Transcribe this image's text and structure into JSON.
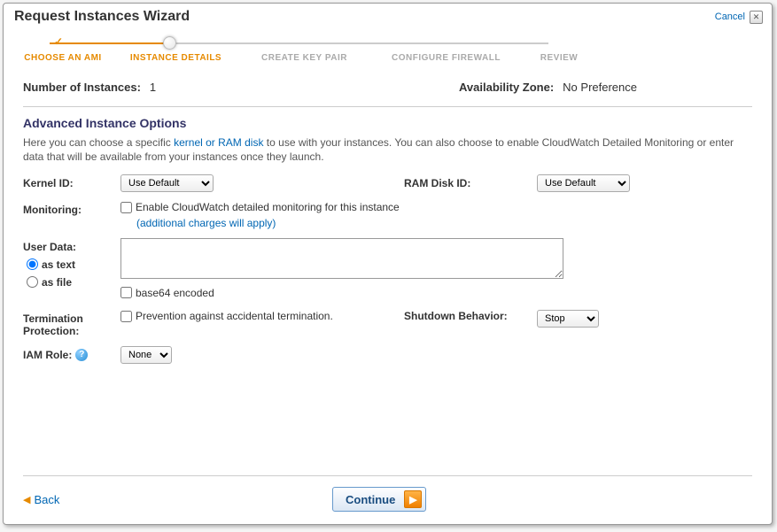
{
  "title": "Request Instances Wizard",
  "cancel": "Cancel",
  "close": "✕",
  "steps": {
    "choose_ami": "CHOOSE AN AMI",
    "instance_details": "INSTANCE DETAILS",
    "create_key_pair": "CREATE KEY PAIR",
    "configure_firewall": "CONFIGURE FIREWALL",
    "review": "REVIEW"
  },
  "top": {
    "num_instances_label": "Number of Instances:",
    "num_instances_value": "1",
    "az_label": "Availability Zone:",
    "az_value": "No Preference"
  },
  "section": {
    "title": "Advanced Instance Options",
    "desc_prefix": "Here you can choose a specific ",
    "desc_link": "kernel or RAM disk",
    "desc_suffix": " to use with your instances. You can also choose to enable CloudWatch Detailed Monitoring or enter data that will be available from your instances once they launch."
  },
  "form": {
    "kernel_label": "Kernel ID:",
    "kernel_value": "Use Default",
    "ram_label": "RAM Disk ID:",
    "ram_value": "Use Default",
    "monitoring_label": "Monitoring:",
    "monitoring_check": "Enable CloudWatch detailed monitoring for this instance",
    "monitoring_charges": "(additional charges will apply)",
    "userdata_label": "User Data:",
    "userdata_as_text": "as text",
    "userdata_as_file": "as file",
    "base64_label": "base64 encoded",
    "term_label": "Termination Protection:",
    "term_check": "Prevention against accidental termination.",
    "shutdown_label": "Shutdown Behavior:",
    "shutdown_value": "Stop",
    "iam_label": "IAM Role:",
    "iam_value": "None"
  },
  "footer": {
    "back": "Back",
    "continue": "Continue"
  }
}
